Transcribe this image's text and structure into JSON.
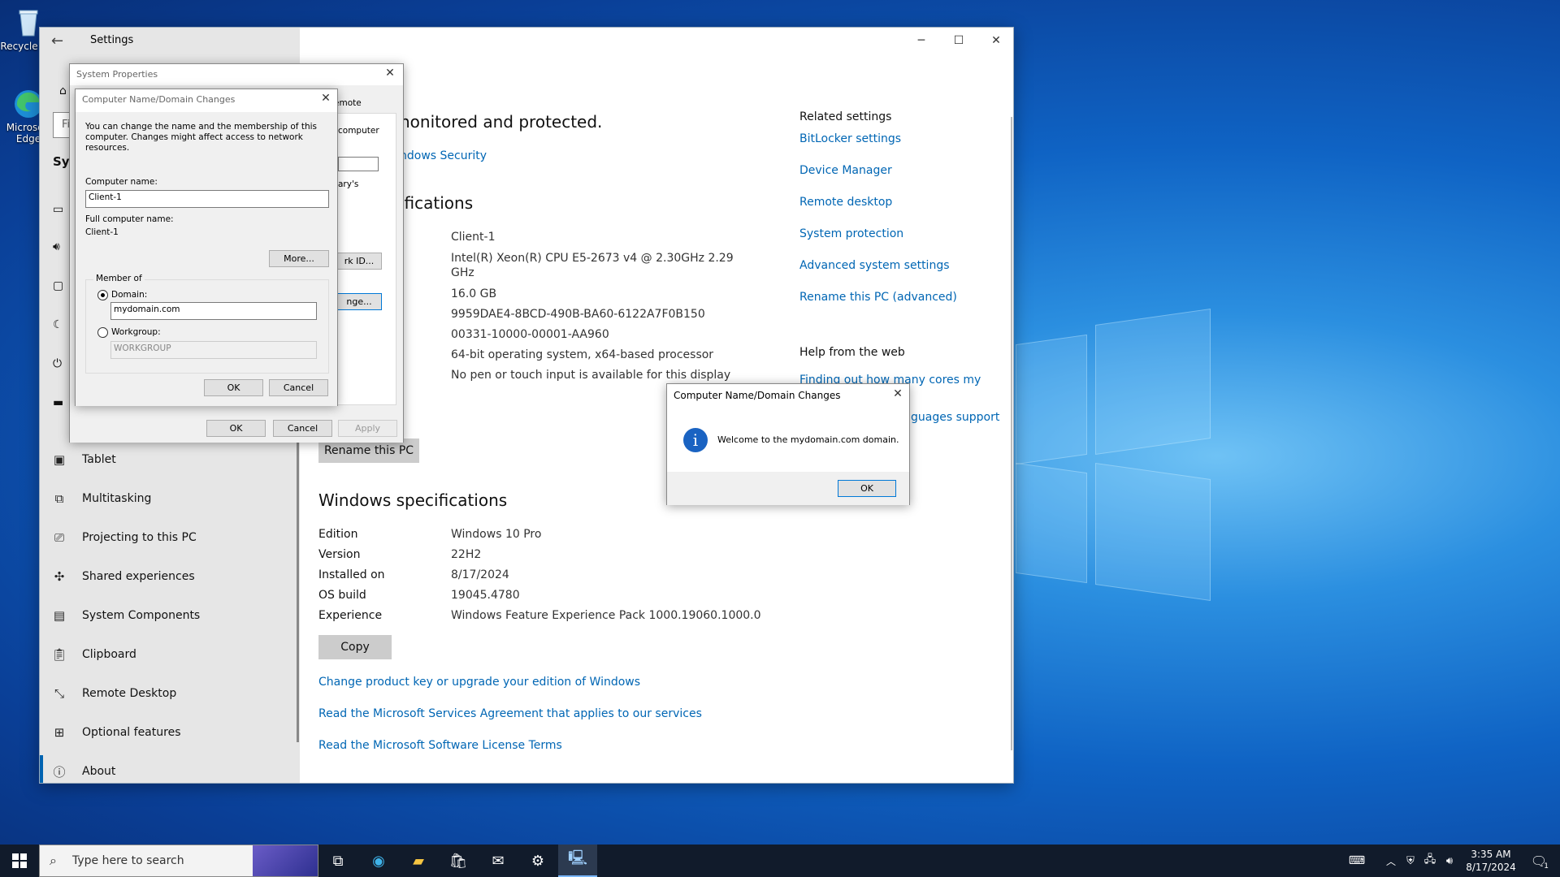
{
  "desktop": {
    "icons": [
      {
        "label": "Recycle Bin",
        "icon": "recycle-bin-icon"
      },
      {
        "label": "Microsoft Edge",
        "icon": "edge-icon"
      }
    ]
  },
  "settings": {
    "title": "Settings",
    "sidebar_items": [
      {
        "label": "Tablet",
        "icon": "tablet-icon"
      },
      {
        "label": "Multitasking",
        "icon": "multitasking-icon"
      },
      {
        "label": "Projecting to this PC",
        "icon": "projecting-icon"
      },
      {
        "label": "Shared experiences",
        "icon": "shared-experiences-icon"
      },
      {
        "label": "System Components",
        "icon": "system-components-icon"
      },
      {
        "label": "Clipboard",
        "icon": "clipboard-icon"
      },
      {
        "label": "Remote Desktop",
        "icon": "remote-desktop-icon"
      },
      {
        "label": "Optional features",
        "icon": "optional-features-icon"
      },
      {
        "label": "About",
        "icon": "about-icon"
      }
    ],
    "sidebar_partial": {
      "search_fragment": "Fi",
      "section_fragment": "Sys"
    },
    "main": {
      "protected_fragment": "nonitored and protected.",
      "security_link_fragment": "ndows Security",
      "device_specs_heading_fragment": "ifications",
      "device_spec_values": [
        "Client-1",
        "Intel(R) Xeon(R) CPU E5-2673 v4 @ 2.30GHz   2.29",
        "GHz",
        "16.0 GB",
        "9959DAE4-8BCD-490B-BA60-6122A7F0B150",
        "00331-10000-00001-AA960",
        "64-bit operating system, x64-based processor",
        "No pen or touch input is available for this display"
      ],
      "rename_button": "Rename this PC",
      "windows_specs_heading": "Windows specifications",
      "windows_specs": [
        {
          "label": "Edition",
          "value": "Windows 10 Pro"
        },
        {
          "label": "Version",
          "value": "22H2"
        },
        {
          "label": "Installed on",
          "value": "8/17/2024"
        },
        {
          "label": "OS build",
          "value": "19045.4780"
        },
        {
          "label": "Experience",
          "value": "Windows Feature Experience Pack 1000.19060.1000.0"
        }
      ],
      "copy_button": "Copy",
      "links": [
        "Change product key or upgrade your edition of Windows",
        "Read the Microsoft Services Agreement that applies to our services",
        "Read the Microsoft Software License Terms"
      ]
    },
    "related": {
      "heading": "Related settings",
      "links": [
        "BitLocker settings",
        "Device Manager",
        "Remote desktop",
        "System protection",
        "Advanced system settings",
        "Rename this PC (advanced)"
      ],
      "help_heading": "Help from the web",
      "help_links": [
        "Finding out how many cores my",
        "guages support"
      ]
    }
  },
  "system_properties": {
    "title": "System Properties",
    "tab_fragment": "emote",
    "fragments": [
      "computer",
      "ary's",
      "rk ID...",
      "nge..."
    ],
    "ok": "OK",
    "cancel": "Cancel",
    "apply": "Apply"
  },
  "domain_changes": {
    "title": "Computer Name/Domain Changes",
    "description": "You can change the name and the membership of this computer. Changes might affect access to network resources.",
    "computer_name_label": "Computer name:",
    "computer_name_value": "Client-1",
    "full_name_label": "Full computer name:",
    "full_name_value": "Client-1",
    "more_button": "More...",
    "member_of_label": "Member of",
    "domain_label": "Domain:",
    "domain_value": "mydomain.com",
    "workgroup_label": "Workgroup:",
    "workgroup_value": "WORKGROUP",
    "ok": "OK",
    "cancel": "Cancel"
  },
  "welcome_dialog": {
    "title": "Computer Name/Domain Changes",
    "message": "Welcome to the mydomain.com domain.",
    "ok": "OK"
  },
  "taskbar": {
    "search_placeholder": "Type here to search",
    "time": "3:35 AM",
    "date": "8/17/2024",
    "notification_count": "1"
  },
  "colors": {
    "accent": "#0063b1",
    "link": "#0066b4",
    "taskbar": "#111b2b"
  }
}
